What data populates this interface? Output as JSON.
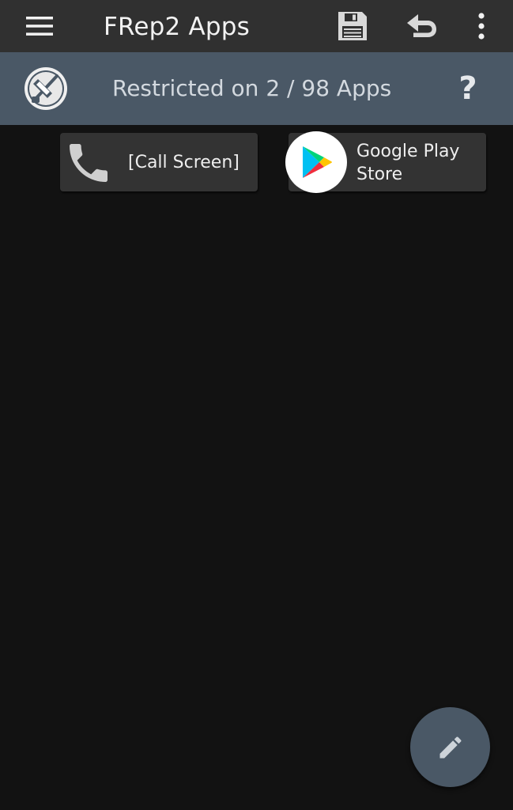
{
  "toolbar": {
    "title": "FRep2 Apps",
    "menu_icon": "hamburger-menu-icon",
    "save_icon": "floppy-disk-icon",
    "undo_icon": "undo-arrow-icon",
    "more_icon": "vertical-dots-icon"
  },
  "status": {
    "text": "Restricted on 2 / 98 Apps",
    "help_label": "?",
    "logo_icon": "frep-logo-icon"
  },
  "apps": [
    {
      "label": "[Call Screen]",
      "icon": "phone-icon"
    },
    {
      "label": "Google Play Store",
      "icon": "google-play-icon"
    }
  ],
  "fab": {
    "icon": "pencil-icon"
  },
  "colors": {
    "background": "#121212",
    "toolbar": "#303030",
    "status_bar": "#4a5866",
    "tile": "#333333",
    "fab": "#4a5866"
  }
}
